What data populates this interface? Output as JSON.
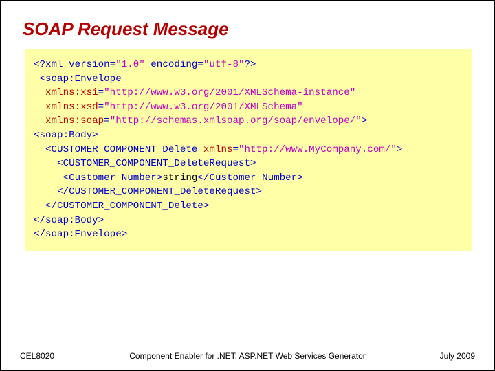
{
  "title": "SOAP Request Message",
  "code": {
    "l01a": "<?xml version=",
    "l01b": "\"1.0\"",
    "l01c": " encoding=",
    "l01d": "\"utf-8\"",
    "l01e": "?>",
    "ws1": " ",
    "l02": "<soap:Envelope",
    "ws2": "  ",
    "l03a": "xmlns:xsi",
    "l03b": "=",
    "l03c": "\"http://www.w3.org/2001/XMLSchema-instance\"",
    "ws3": "  ",
    "l04a": "xmlns:xsd",
    "l04b": "=",
    "l04c": "\"http://www.w3.org/2001/XMLSchema\"",
    "ws4": "  ",
    "l05a": "xmlns:soap",
    "l05b": "=",
    "l05c": "\"http://schemas.xmlsoap.org/soap/envelope/\"",
    "l05d": ">",
    "l06": "<soap:Body>",
    "ws5": "  ",
    "l07a": "<CUSTOMER_COMPONENT_Delete ",
    "l07b": "xmlns",
    "l07c": "=",
    "l07d": "\"http://www.MyCompany.com/\"",
    "l07e": ">",
    "ws6": "    ",
    "l08": "<CUSTOMER_COMPONENT_DeleteRequest>",
    "ws7": "     ",
    "l09a": "<Customer Number>",
    "l09b": "string",
    "l09c": "</Customer Number>",
    "ws8": "    ",
    "l10": "</CUSTOMER_COMPONENT_DeleteRequest>",
    "ws9": "  ",
    "l11": "</CUSTOMER_COMPONENT_Delete>",
    "l12": "</soap:Body>",
    "l13": "</soap:Envelope>"
  },
  "footer": {
    "left": "CEL8020",
    "center": "Component Enabler for .NET: ASP.NET Web Services Generator",
    "right": "July 2009"
  }
}
